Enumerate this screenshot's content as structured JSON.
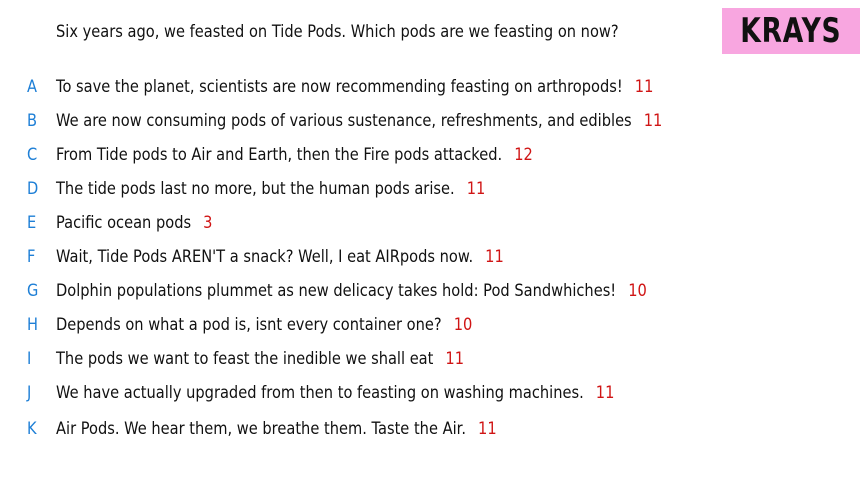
{
  "question": "Six years ago, we feasted on Tide Pods. Which pods are we feasting on now?",
  "brand": {
    "label": "KRAYS",
    "background_color": "#f8a6e0"
  },
  "colors": {
    "letter": "#1e7fd6",
    "score": "#d01515",
    "text": "#111111"
  },
  "answers": [
    {
      "letter": "A",
      "text": "To save the planet, scientists are now recommending feasting on arthropods!",
      "score": "11"
    },
    {
      "letter": "B",
      "text": "We are now consuming pods of various sustenance, refreshments, and edibles",
      "score": "11"
    },
    {
      "letter": "C",
      "text": "From Tide pods to Air and Earth, then the Fire pods attacked.",
      "score": "12"
    },
    {
      "letter": "D",
      "text": "The tide pods last no more, but the human pods arise.",
      "score": "11"
    },
    {
      "letter": "E",
      "text": "Pacific ocean pods",
      "score": "3"
    },
    {
      "letter": "F",
      "text": "Wait, Tide Pods AREN'T a snack? Well, I eat AIRpods now.",
      "score": "11"
    },
    {
      "letter": "G",
      "text": "Dolphin populations plummet as new delicacy takes hold: Pod Sandwhiches!",
      "score": "10"
    },
    {
      "letter": "H",
      "text": "Depends on what a pod is, isnt every container one?",
      "score": "10"
    },
    {
      "letter": "I",
      "text": "The pods we want to feast the inedible we shall eat",
      "score": "11"
    },
    {
      "letter": "J",
      "text": "We have actually upgraded from then to feasting on washing machines.",
      "score": "11"
    },
    {
      "letter": "K",
      "text": "Air Pods. We hear them, we breathe them. Taste the Air.",
      "score": "11"
    }
  ]
}
